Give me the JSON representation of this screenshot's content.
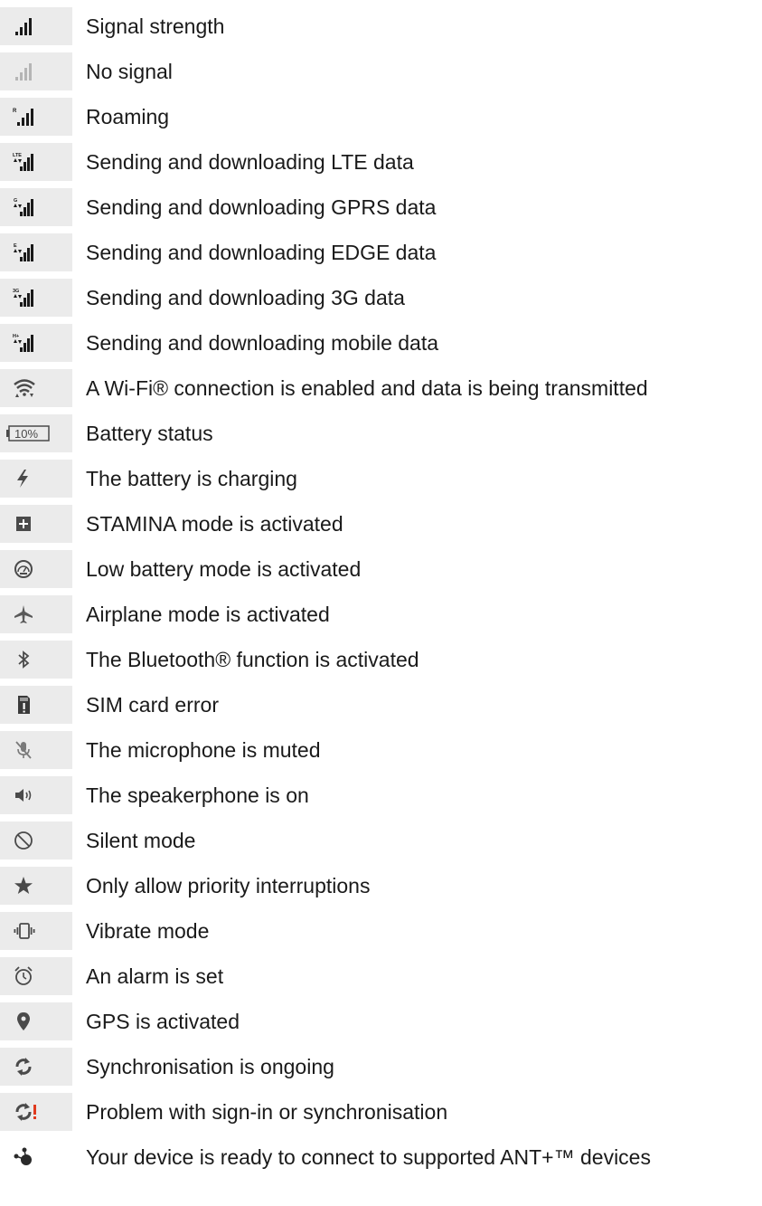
{
  "items": [
    {
      "icon": "signal-strength-icon",
      "label": "Signal strength"
    },
    {
      "icon": "no-signal-icon",
      "label": "No signal"
    },
    {
      "icon": "roaming-icon",
      "label": "Roaming",
      "icon_text": "R"
    },
    {
      "icon": "lte-data-icon",
      "label": "Sending and downloading LTE data",
      "icon_text": "LTE"
    },
    {
      "icon": "gprs-data-icon",
      "label": "Sending and downloading GPRS data",
      "icon_text": "G"
    },
    {
      "icon": "edge-data-icon",
      "label": "Sending and downloading EDGE data",
      "icon_text": "E"
    },
    {
      "icon": "3g-data-icon",
      "label": "Sending and downloading 3G data",
      "icon_text": "3G"
    },
    {
      "icon": "mobile-data-icon",
      "label": "Sending and downloading mobile data",
      "icon_text": "H+"
    },
    {
      "icon": "wifi-icon",
      "label": "A Wi-Fi® connection is enabled and data is being transmitted"
    },
    {
      "icon": "battery-icon",
      "label": "Battery status",
      "icon_text": "10%"
    },
    {
      "icon": "charging-icon",
      "label": "The battery is charging"
    },
    {
      "icon": "stamina-icon",
      "label": "STAMINA mode is activated"
    },
    {
      "icon": "low-battery-mode-icon",
      "label": "Low battery mode is activated"
    },
    {
      "icon": "airplane-icon",
      "label": "Airplane mode is activated"
    },
    {
      "icon": "bluetooth-icon",
      "label": "The Bluetooth® function is activated"
    },
    {
      "icon": "sim-error-icon",
      "label": "SIM card error"
    },
    {
      "icon": "mic-muted-icon",
      "label": "The microphone is muted"
    },
    {
      "icon": "speakerphone-icon",
      "label": "The speakerphone is on"
    },
    {
      "icon": "silent-mode-icon",
      "label": "Silent mode"
    },
    {
      "icon": "star-icon",
      "label": "Only allow priority interruptions"
    },
    {
      "icon": "vibrate-icon",
      "label": "Vibrate mode"
    },
    {
      "icon": "alarm-icon",
      "label": "An alarm is set"
    },
    {
      "icon": "gps-icon",
      "label": "GPS is activated"
    },
    {
      "icon": "sync-icon",
      "label": "Synchronisation is ongoing"
    },
    {
      "icon": "sync-problem-icon",
      "label": "Problem with sign-in or synchronisation"
    },
    {
      "icon": "ant-plus-icon",
      "label": "Your device is ready to connect  to supported ANT+™ devices"
    }
  ],
  "colors": {
    "icon_bg": "#ebebeb",
    "icon_dark": "#1a1a1a",
    "icon_grey": "#9a9a9a",
    "error_red": "#e03a1e"
  }
}
